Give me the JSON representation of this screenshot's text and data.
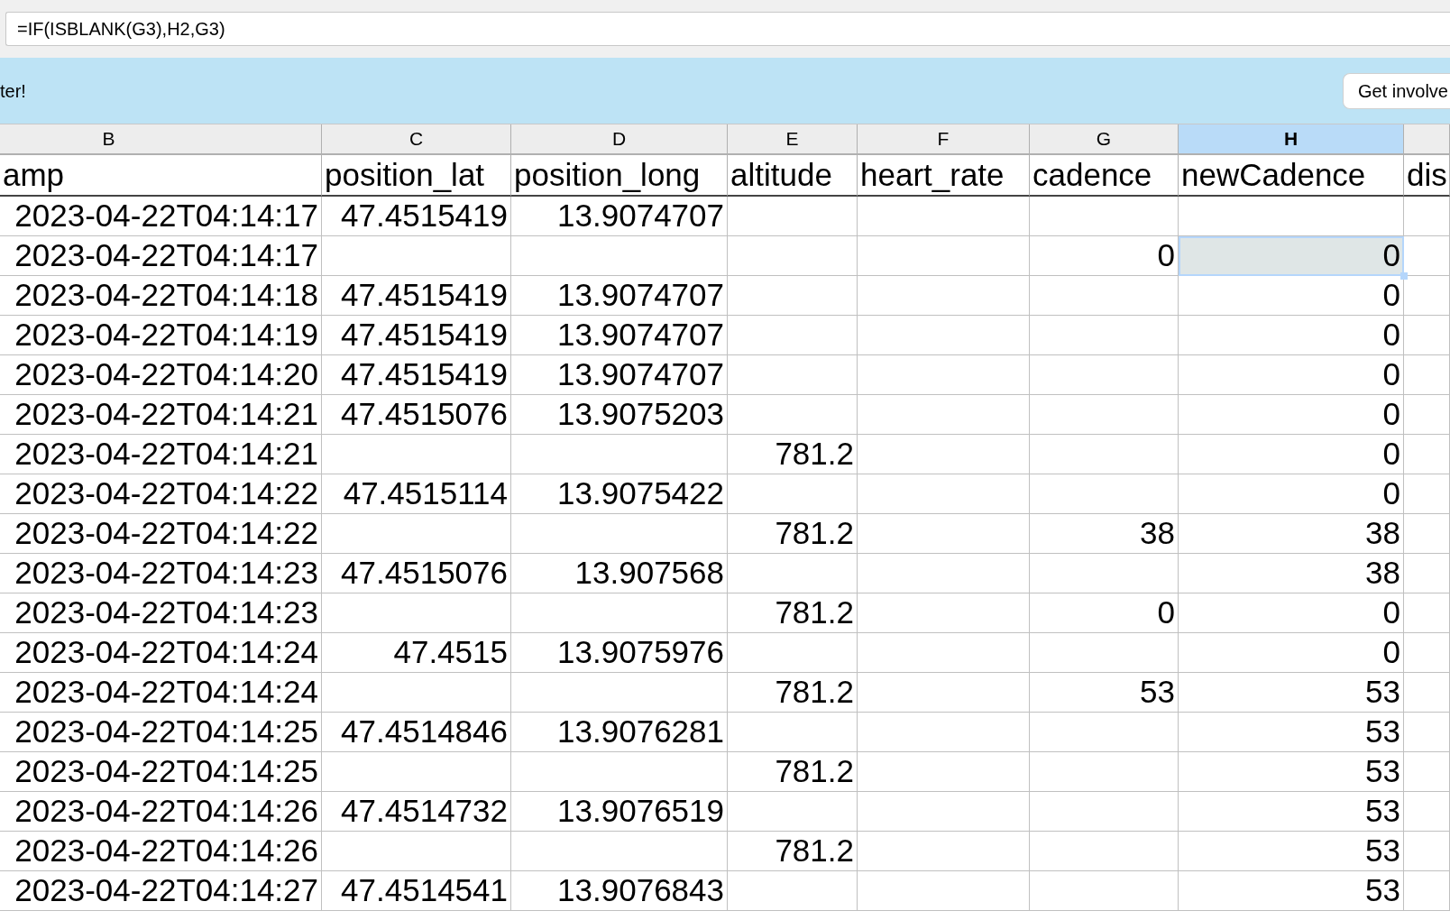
{
  "formula_bar": {
    "value": "=IF(ISBLANK(G3),H2,G3)"
  },
  "banner": {
    "text": "ter!",
    "button": "Get involve"
  },
  "columns": [
    {
      "letter": "B",
      "selected": false
    },
    {
      "letter": "C",
      "selected": false
    },
    {
      "letter": "D",
      "selected": false
    },
    {
      "letter": "E",
      "selected": false
    },
    {
      "letter": "F",
      "selected": false
    },
    {
      "letter": "G",
      "selected": false
    },
    {
      "letter": "H",
      "selected": true
    },
    {
      "selected": false
    }
  ],
  "header_row": [
    "amp",
    "position_lat",
    "position_long",
    "altitude",
    "heart_rate",
    "cadence",
    "newCadence",
    "dis"
  ],
  "rows": [
    {
      "selected": false,
      "cells": [
        "2023-04-22T04:14:17",
        "47.4515419",
        "13.9074707",
        null,
        null,
        null,
        null,
        null
      ]
    },
    {
      "selected": true,
      "cells": [
        "2023-04-22T04:14:17",
        null,
        null,
        null,
        null,
        "0",
        "0",
        null
      ]
    },
    {
      "selected": false,
      "cells": [
        "2023-04-22T04:14:18",
        "47.4515419",
        "13.9074707",
        null,
        null,
        null,
        "0",
        null
      ]
    },
    {
      "selected": false,
      "cells": [
        "2023-04-22T04:14:19",
        "47.4515419",
        "13.9074707",
        null,
        null,
        null,
        "0",
        null
      ]
    },
    {
      "selected": false,
      "cells": [
        "2023-04-22T04:14:20",
        "47.4515419",
        "13.9074707",
        null,
        null,
        null,
        "0",
        null
      ]
    },
    {
      "selected": false,
      "cells": [
        "2023-04-22T04:14:21",
        "47.4515076",
        "13.9075203",
        null,
        null,
        null,
        "0",
        null
      ]
    },
    {
      "selected": false,
      "cells": [
        "2023-04-22T04:14:21",
        null,
        null,
        "781.2",
        null,
        null,
        "0",
        null
      ]
    },
    {
      "selected": false,
      "cells": [
        "2023-04-22T04:14:22",
        "47.4515114",
        "13.9075422",
        null,
        null,
        null,
        "0",
        null
      ]
    },
    {
      "selected": false,
      "cells": [
        "2023-04-22T04:14:22",
        null,
        null,
        "781.2",
        null,
        "38",
        "38",
        null
      ]
    },
    {
      "selected": false,
      "cells": [
        "2023-04-22T04:14:23",
        "47.4515076",
        "13.907568",
        null,
        null,
        null,
        "38",
        null
      ]
    },
    {
      "selected": false,
      "cells": [
        "2023-04-22T04:14:23",
        null,
        null,
        "781.2",
        null,
        "0",
        "0",
        null
      ]
    },
    {
      "selected": false,
      "cells": [
        "2023-04-22T04:14:24",
        "47.4515",
        "13.9075976",
        null,
        null,
        null,
        "0",
        null
      ]
    },
    {
      "selected": false,
      "cells": [
        "2023-04-22T04:14:24",
        null,
        null,
        "781.2",
        null,
        "53",
        "53",
        null
      ]
    },
    {
      "selected": false,
      "cells": [
        "2023-04-22T04:14:25",
        "47.4514846",
        "13.9076281",
        null,
        null,
        null,
        "53",
        null
      ]
    },
    {
      "selected": false,
      "cells": [
        "2023-04-22T04:14:25",
        null,
        null,
        "781.2",
        null,
        null,
        "53",
        null
      ]
    },
    {
      "selected": false,
      "cells": [
        "2023-04-22T04:14:26",
        "47.4514732",
        "13.9076519",
        null,
        null,
        null,
        "53",
        null
      ]
    },
    {
      "selected": false,
      "cells": [
        "2023-04-22T04:14:26",
        null,
        null,
        "781.2",
        null,
        null,
        "53",
        null
      ]
    },
    {
      "selected": false,
      "cells": [
        "2023-04-22T04:14:27",
        "47.4514541",
        "13.9076843",
        null,
        null,
        null,
        "53",
        null
      ]
    }
  ]
}
